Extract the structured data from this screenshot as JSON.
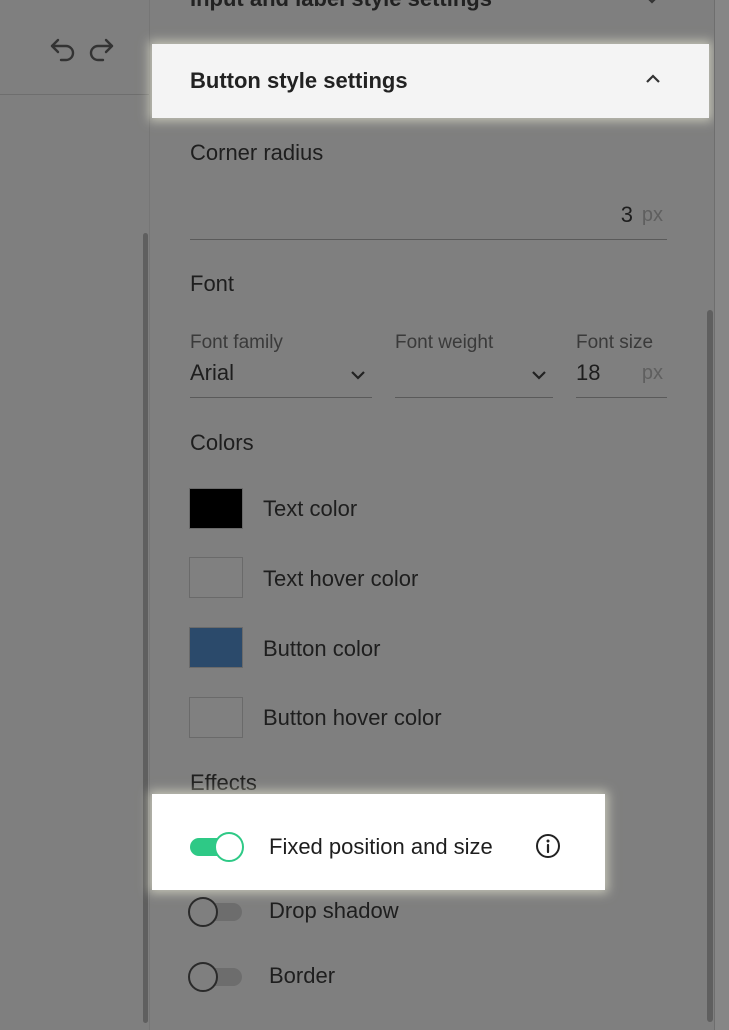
{
  "previous_section": {
    "title": "Input and label style settings"
  },
  "section": {
    "title": "Button style settings"
  },
  "corner_radius": {
    "label": "Corner radius",
    "value": "3",
    "unit": "px"
  },
  "font": {
    "heading": "Font",
    "family_label": "Font family",
    "family_value": "Arial",
    "weight_label": "Font weight",
    "weight_value": "",
    "size_label": "Font size",
    "size_value": "18",
    "size_unit": "px"
  },
  "colors": {
    "heading": "Colors",
    "items": [
      {
        "label": "Text color",
        "swatch": "#000000"
      },
      {
        "label": "Text hover color",
        "swatch": "#808080"
      },
      {
        "label": "Button color",
        "swatch": "#2b4a6b"
      },
      {
        "label": "Button hover color",
        "swatch": "#808080"
      }
    ]
  },
  "effects": {
    "heading": "Effects",
    "items": [
      {
        "label": "Fixed position and size",
        "enabled": true
      },
      {
        "label": "Drop shadow",
        "enabled": false
      },
      {
        "label": "Border",
        "enabled": false
      }
    ]
  },
  "theme": {
    "accent": "#2ec986",
    "overlay": "#7f7f7f",
    "highlight": "#f4f4f4"
  },
  "icons": {
    "undo": "undo-icon",
    "redo": "redo-icon",
    "collapse": "chevron-up-icon",
    "info": "info-icon"
  }
}
